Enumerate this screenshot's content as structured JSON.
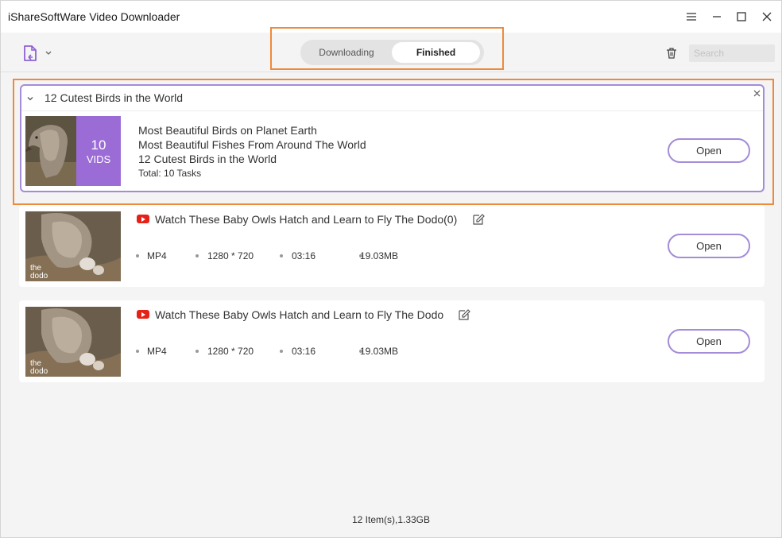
{
  "window": {
    "title": "iShareSoftWare Video Downloader"
  },
  "toolbar": {
    "tabs": [
      {
        "label": "Downloading",
        "active": false
      },
      {
        "label": "Finished",
        "active": true
      }
    ],
    "search_placeholder": "Search",
    "accent_color": "#a48cd8"
  },
  "playlist": {
    "title": "12 Cutest Birds in the World",
    "count": "10",
    "count_label": "VIDS",
    "items": [
      "Most Beautiful Birds on Planet Earth",
      "Most Beautiful Fishes From Around The World",
      "12 Cutest Birds in the World"
    ],
    "total": "Total: 10 Tasks",
    "open_label": "Open"
  },
  "videos": [
    {
      "title": "Watch These Baby Owls Hatch and Learn to Fly  The Dodo(0)",
      "format": "MP4",
      "resolution": "1280 * 720",
      "duration": "03:16",
      "size": "19.03MB",
      "open_label": "Open"
    },
    {
      "title": "Watch These Baby Owls Hatch and Learn to Fly  The Dodo",
      "format": "MP4",
      "resolution": "1280 * 720",
      "duration": "03:16",
      "size": "19.03MB",
      "open_label": "Open"
    }
  ],
  "status_bar": {
    "text": "12 Item(s),1.33GB"
  }
}
